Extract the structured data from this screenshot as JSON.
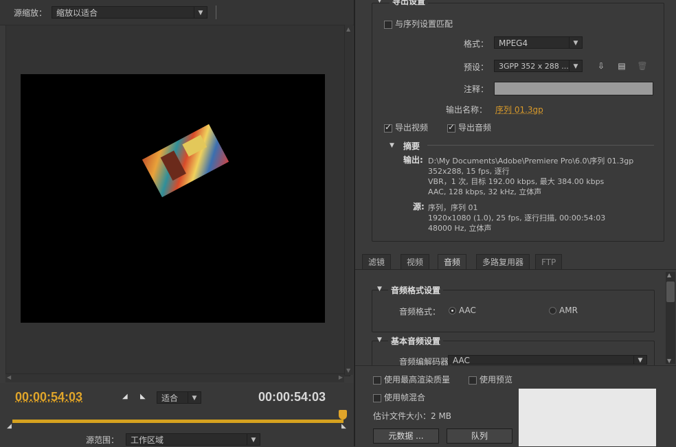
{
  "source": {
    "zoom_label": "源缩放：",
    "zoom_value": "缩放以适合"
  },
  "timecode": {
    "current": "00:00:54:03",
    "duration": "00:00:54:03",
    "fit_value": "适合"
  },
  "range": {
    "label": "源范围：",
    "value": "工作区域"
  },
  "export": {
    "section_title": "导出设置",
    "match_sequence": "与序列设置匹配",
    "format_label": "格式：",
    "format_value": "MPEG4",
    "preset_label": "预设：",
    "preset_value": "3GPP 352 x 288 ...",
    "comment_label": "注释：",
    "output_name_label": "输出名称：",
    "output_name_value": "序列 01.3gp",
    "export_video": "导出视频",
    "export_audio": "导出音频",
    "summary_title": "摘要",
    "output_label": "输出:",
    "output_lines": [
      "D:\\My Documents\\Adobe\\Premiere Pro\\6.0\\序列 01.3gp",
      "352x288, 15 fps, 逐行",
      "VBR，1 次, 目标 192.00 kbps, 最大 384.00 kbps",
      "AAC, 128 kbps, 32 kHz, 立体声"
    ],
    "source_label": "源:",
    "source_lines": [
      "序列，序列 01",
      "1920x1080 (1.0), 25 fps, 逐行扫描, 00:00:54:03",
      "48000 Hz, 立体声"
    ]
  },
  "tabs": [
    "滤镜",
    "视频",
    "音频",
    "多路复用器",
    "FTP"
  ],
  "audio": {
    "format_section": "音频格式设置",
    "format_label": "音频格式：",
    "option_aac": "AAC",
    "option_amr": "AMR",
    "basic_section": "基本音频设置",
    "codec_label": "音频编解码器：",
    "codec_value": "AAC"
  },
  "bottom": {
    "max_quality": "使用最高渲染质量",
    "use_preview": "使用预览",
    "frame_blend": "使用帧混合",
    "filesize": "估计文件大小：2 MB",
    "metadata_button": "元数据 ...",
    "queue_button": "队列"
  }
}
